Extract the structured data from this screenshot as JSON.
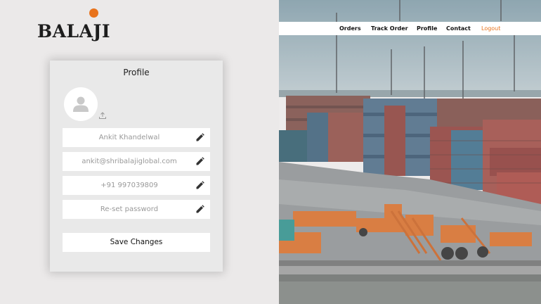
{
  "brand": {
    "logo_text": "BALAJI",
    "accent": "#e8731c"
  },
  "profile": {
    "title": "Profile",
    "fields": [
      {
        "value": "Ankit Khandelwal",
        "icon": "pencil-icon"
      },
      {
        "value": "ankit@shribalajiglobal.com",
        "icon": "pencil-icon"
      },
      {
        "value": "+91 997039809",
        "icon": "pencil-icon"
      },
      {
        "value": "Re-set password",
        "icon": "pencil-icon"
      }
    ],
    "save_label": "Save Changes"
  },
  "nav": {
    "items": [
      "Orders",
      "Track Order",
      "Profile",
      "Contact"
    ],
    "logout": "Logout"
  }
}
